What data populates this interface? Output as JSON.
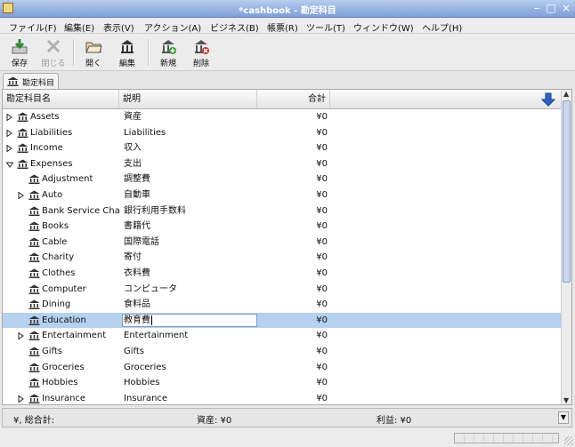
{
  "window": {
    "title": "*cashbook - 勘定科目"
  },
  "menu": [
    "ファイル(F)",
    "編集(E)",
    "表示(V)",
    "アクション(A)",
    "ビジネス(B)",
    "帳票(R)",
    "ツール(T)",
    "ウィンドウ(W)",
    "ヘルプ(H)"
  ],
  "toolbar": {
    "save": "保存",
    "close": "閉じる",
    "open": "開く",
    "edit": "編集",
    "new": "新規",
    "delete": "削除"
  },
  "tab": {
    "label": "勘定科目"
  },
  "columns": {
    "name": "勘定科目名",
    "description": "説明",
    "total": "合計"
  },
  "rows": [
    {
      "name": "Assets",
      "desc": "資産",
      "total": "¥0"
    },
    {
      "name": "Liabilities",
      "desc": "Liabilities",
      "total": "¥0"
    },
    {
      "name": "Income",
      "desc": "収入",
      "total": "¥0"
    },
    {
      "name": "Expenses",
      "desc": "支出",
      "total": "¥0"
    },
    {
      "name": "Adjustment",
      "desc": "調整費",
      "total": "¥0"
    },
    {
      "name": "Auto",
      "desc": "自動車",
      "total": "¥0"
    },
    {
      "name": "Bank Service Char",
      "desc": "銀行利用手数料",
      "total": "¥0"
    },
    {
      "name": "Books",
      "desc": "書籍代",
      "total": "¥0"
    },
    {
      "name": "Cable",
      "desc": "国際電話",
      "total": "¥0"
    },
    {
      "name": "Charity",
      "desc": "寄付",
      "total": "¥0"
    },
    {
      "name": "Clothes",
      "desc": "衣料費",
      "total": "¥0"
    },
    {
      "name": "Computer",
      "desc": "コンピュータ",
      "total": "¥0"
    },
    {
      "name": "Dining",
      "desc": "食料品",
      "total": "¥0"
    },
    {
      "name": "Education",
      "desc": "教育費",
      "total": "¥0"
    },
    {
      "name": "Entertainment",
      "desc": "Entertainment",
      "total": "¥0"
    },
    {
      "name": "Gifts",
      "desc": "Gifts",
      "total": "¥0"
    },
    {
      "name": "Groceries",
      "desc": "Groceries",
      "total": "¥0"
    },
    {
      "name": "Hobbies",
      "desc": "Hobbies",
      "total": "¥0"
    },
    {
      "name": "Insurance",
      "desc": "Insurance",
      "total": "¥0"
    }
  ],
  "summary": {
    "currency": "¥, 総合計:",
    "assets": "資産: ¥0",
    "profit": "利益: ¥0"
  },
  "colors": {
    "selection": "#b6d0ef",
    "titlebar": "#7f9fd6"
  }
}
